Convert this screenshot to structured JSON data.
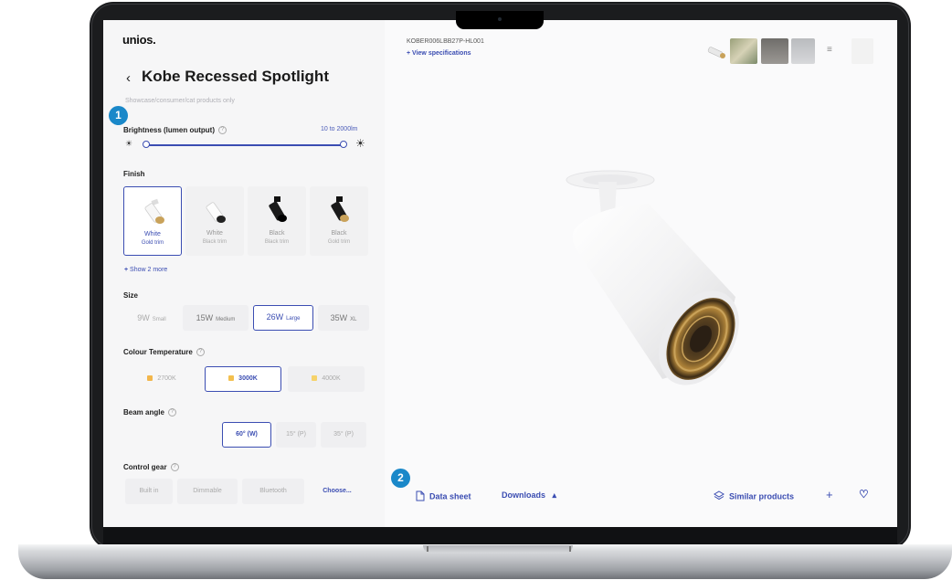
{
  "app": {
    "logo": "unios."
  },
  "product": {
    "title": "Kobe Recessed Spotlight",
    "subtitle": "Showcase/consumer/cat products only",
    "sku": "KOBER006LBB27P-HL001",
    "view_specs": "View specifications"
  },
  "badges": {
    "one": "1",
    "two": "2"
  },
  "brightness": {
    "label": "Brightness (lumen output)",
    "range": "10 to 2000lm",
    "value_fraction": 1.0
  },
  "finish": {
    "label": "Finish",
    "options": [
      {
        "name": "White",
        "trim": "Gold trim",
        "selected": true,
        "body": "#ffffff",
        "accent": "#c9a25a"
      },
      {
        "name": "White",
        "trim": "Black trim",
        "selected": false,
        "body": "#ffffff",
        "accent": "#222222"
      },
      {
        "name": "Black",
        "trim": "Black trim",
        "selected": false,
        "body": "#1a1a1a",
        "accent": "#1a1a1a"
      },
      {
        "name": "Black",
        "trim": "Gold trim",
        "selected": false,
        "body": "#1a1a1a",
        "accent": "#c9a25a"
      }
    ],
    "show_more": "Show 2 more"
  },
  "size": {
    "label": "Size",
    "options": [
      {
        "value": "9W",
        "tag": "Small"
      },
      {
        "value": "15W",
        "tag": "Medium"
      },
      {
        "value": "26W",
        "tag": "Large"
      },
      {
        "value": "35W",
        "tag": "XL"
      }
    ]
  },
  "colour_temperature": {
    "label": "Colour Temperature",
    "options": [
      {
        "value": "2700K",
        "swatch": "#f2b64c"
      },
      {
        "value": "3000K",
        "swatch": "#f3c04f"
      },
      {
        "value": "4000K",
        "swatch": "#f6d26a"
      }
    ]
  },
  "beam_angle": {
    "label": "Beam angle",
    "options": [
      "60° (W)",
      "15° (P)",
      "35° (P)"
    ]
  },
  "control_gear": {
    "label": "Control gear",
    "options": [
      "Built in",
      "Dimmable",
      "Bluetooth",
      "Choose..."
    ]
  },
  "actions": {
    "data_sheet": "Data sheet",
    "downloads": "Downloads",
    "similar": "Similar products",
    "plus": "+",
    "heart": "♡"
  },
  "colors": {
    "accent": "#3b4db2",
    "badge": "#1a88c9",
    "gold": "#c9a25a"
  }
}
